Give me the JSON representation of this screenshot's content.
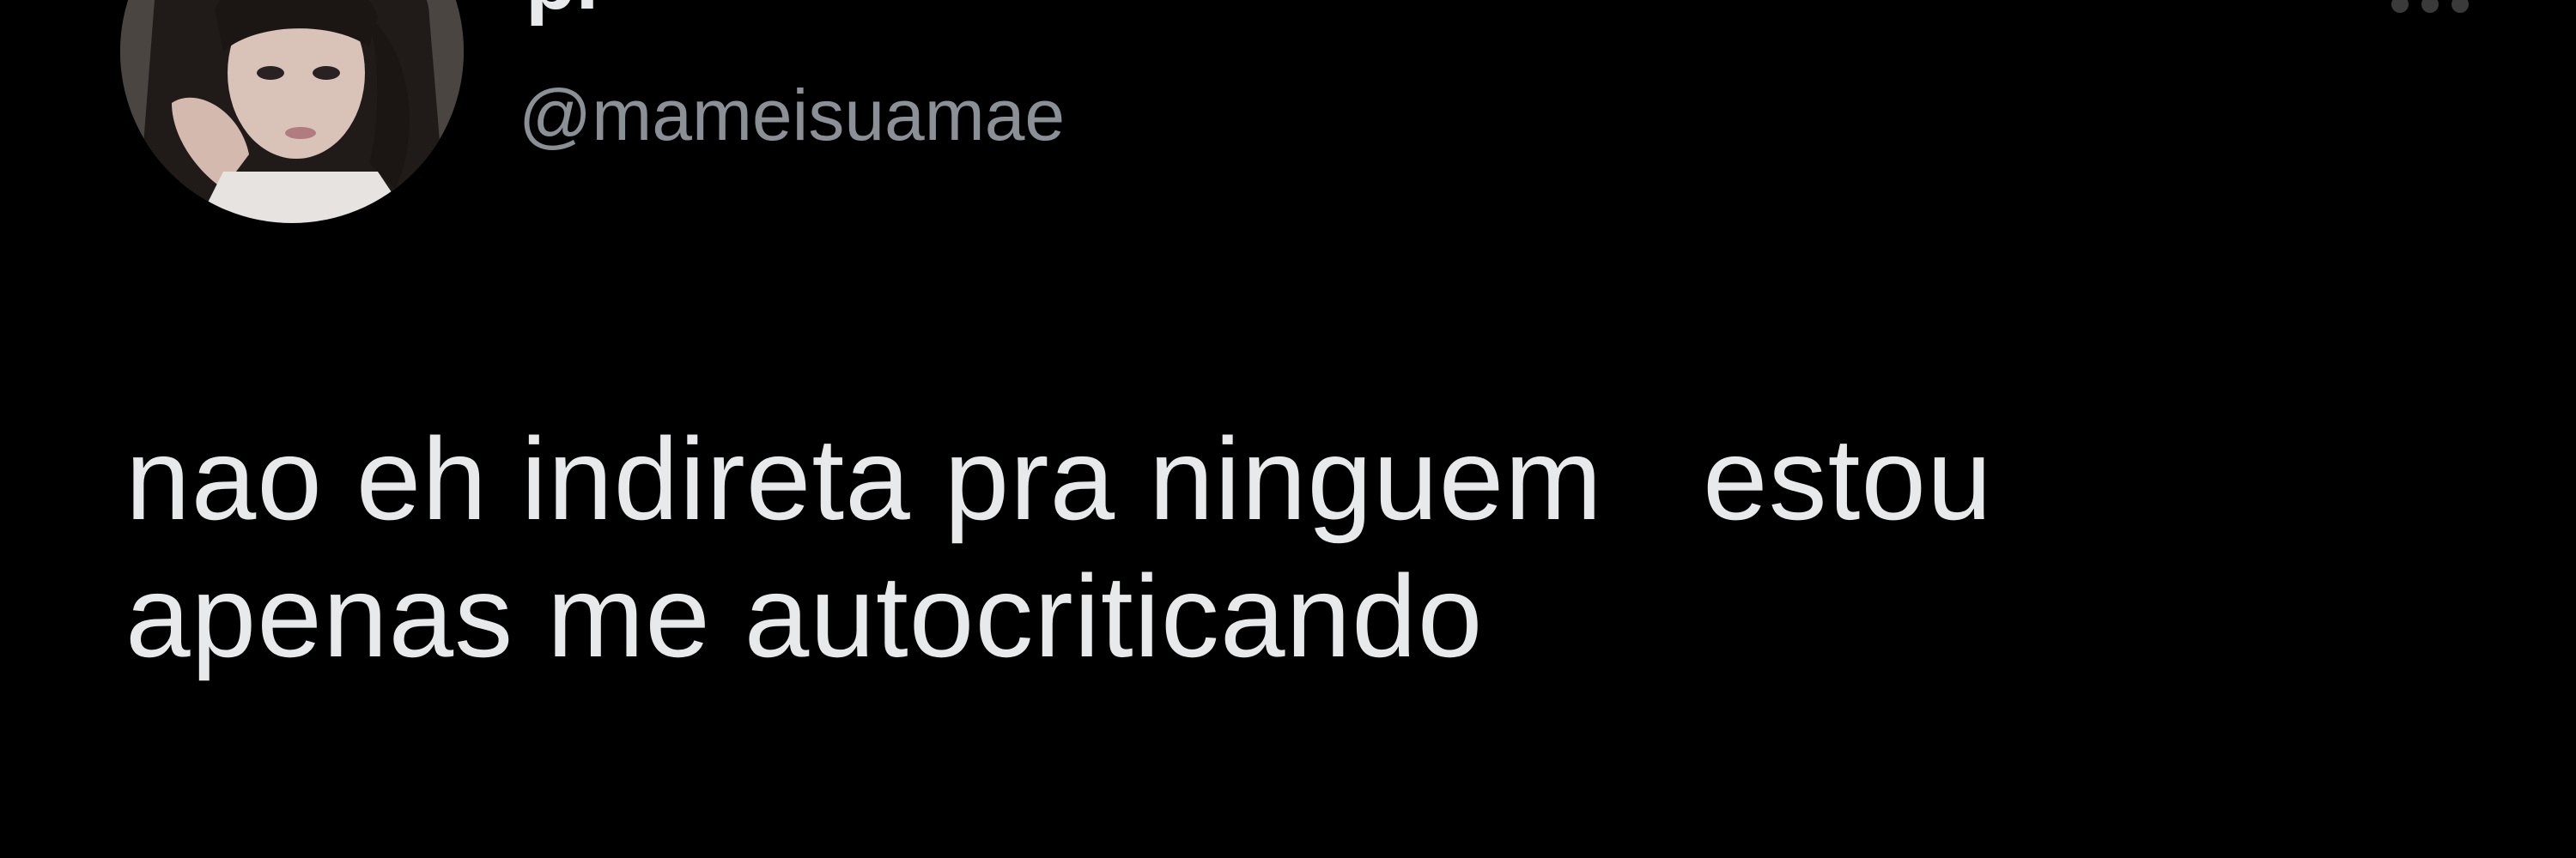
{
  "tweet": {
    "display_name": "p.",
    "handle": "@mameisuamae",
    "text_lines": [
      "nao eh indireta pra ninguem   estou",
      "apenas me autocriticando"
    ]
  },
  "icons": {
    "avatar": "profile-photo",
    "more": "more-options-icon"
  },
  "colors": {
    "background": "#000000",
    "text_primary": "#e7e9ea",
    "text_secondary": "#8b9096"
  }
}
